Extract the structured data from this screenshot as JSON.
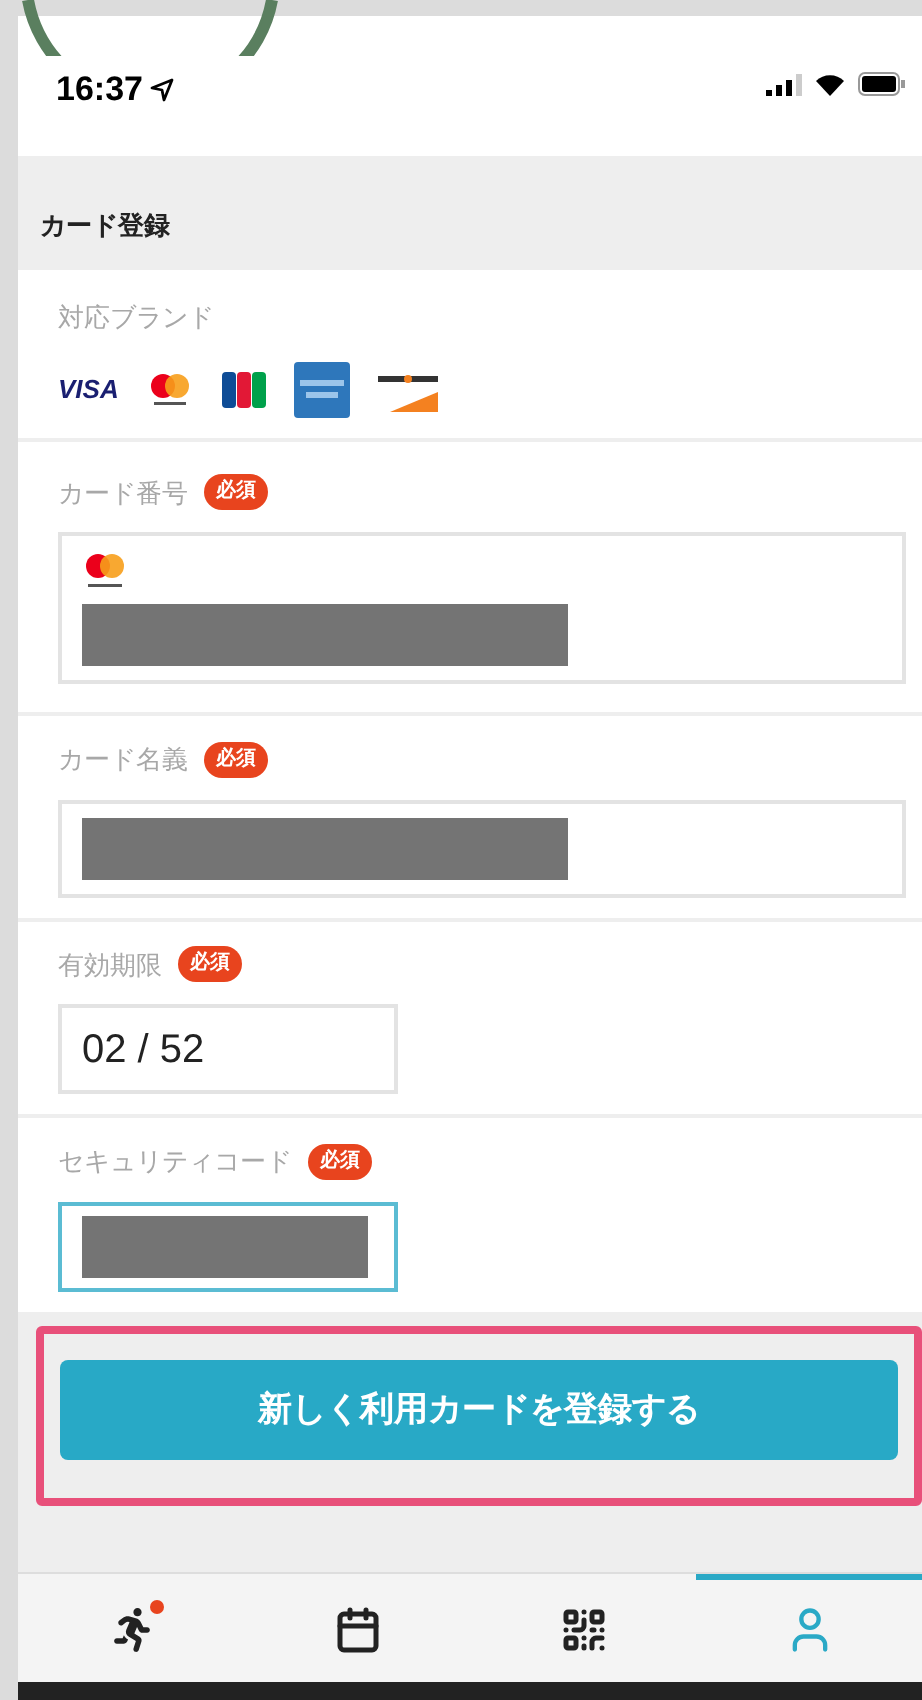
{
  "status_bar": {
    "time": "16:37"
  },
  "header": {
    "title": "カード登録"
  },
  "brands": {
    "label": "対応ブランド",
    "items": [
      {
        "kind": "visa",
        "label": "VISA"
      },
      {
        "kind": "mastercard"
      },
      {
        "kind": "jcb"
      },
      {
        "kind": "amex"
      },
      {
        "kind": "discover"
      }
    ]
  },
  "fields": [
    {
      "kind": "card_number",
      "label": "カード番号",
      "badge": "必須",
      "redacted": true,
      "focused": false
    },
    {
      "kind": "wide",
      "label": "カード名義",
      "badge": "必須",
      "redacted": true,
      "focused": false
    },
    {
      "kind": "short",
      "label": "有効期限",
      "badge": "必須",
      "value": "02 / 52",
      "redacted": false,
      "focused": false
    },
    {
      "kind": "short",
      "label": "セキュリティコード",
      "badge": "必須",
      "redacted": true,
      "focused": true
    }
  ],
  "submit_button": {
    "label": "新しく利用カードを登録する",
    "highlighted": true
  },
  "bottom_nav": [
    {
      "kind": "activity",
      "selected": false,
      "notification": true
    },
    {
      "kind": "calendar",
      "selected": false,
      "notification": false
    },
    {
      "kind": "qr",
      "selected": false,
      "notification": false
    },
    {
      "kind": "profile",
      "selected": true,
      "notification": false
    }
  ]
}
